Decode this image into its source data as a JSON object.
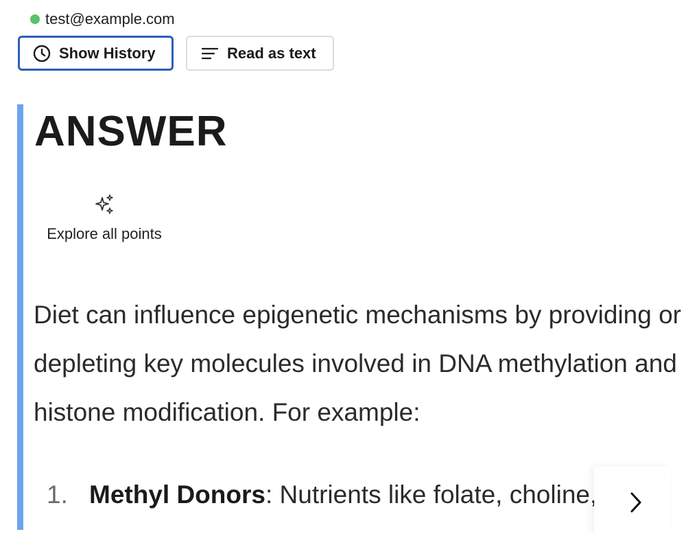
{
  "account": {
    "email": "test@example.com",
    "status_color": "#5ac26b"
  },
  "toolbar": {
    "history_label": "Show History",
    "history_icon": "clock-icon",
    "read_label": "Read as text",
    "read_icon": "text-lines-icon"
  },
  "answer": {
    "title": "ANSWER",
    "explore_icon": "sparkles-icon",
    "explore_label": "Explore all points",
    "body": "Diet can influence epigenetic mechanisms by providing or depleting key molecules involved in DNA methylation and histone modification. For example:",
    "list": [
      {
        "number": "1.",
        "term": "Methyl Donors",
        "text": ": Nutrients like folate, choline,"
      }
    ],
    "next_icon": "chevron-right-icon",
    "accent_color": "#6ea3ec"
  }
}
